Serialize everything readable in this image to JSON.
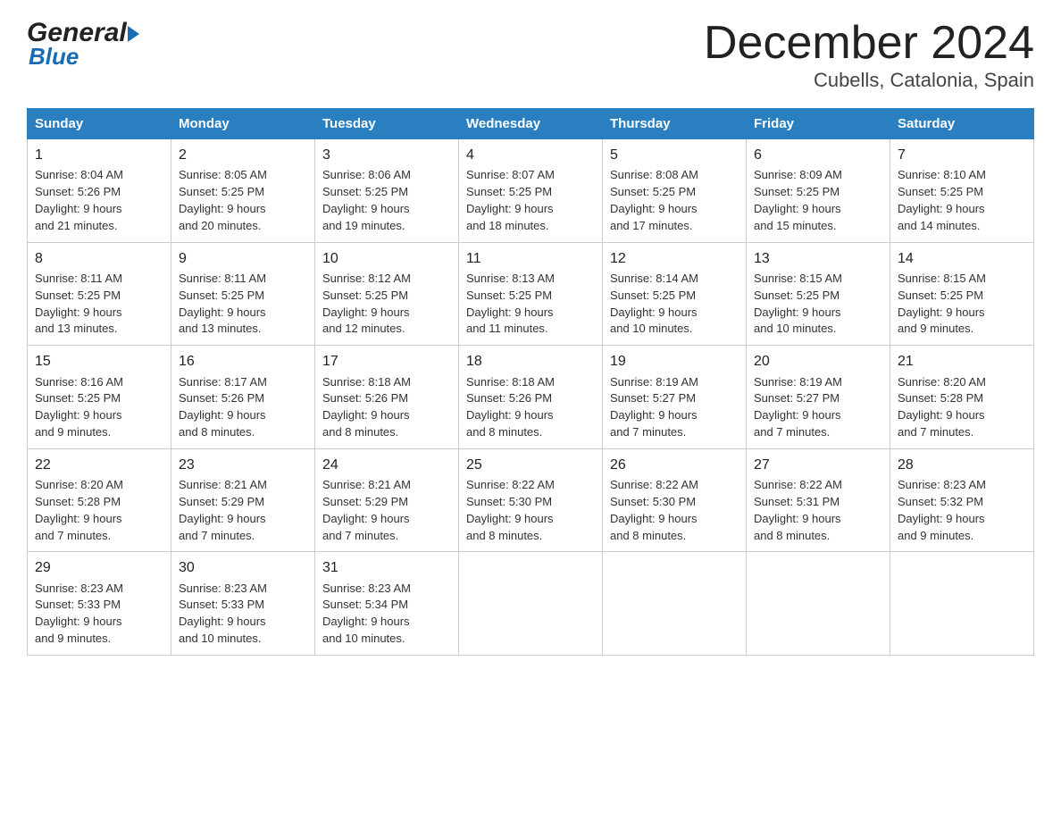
{
  "header": {
    "month": "December 2024",
    "location": "Cubells, Catalonia, Spain",
    "logo_general": "General",
    "logo_blue": "Blue"
  },
  "weekdays": [
    "Sunday",
    "Monday",
    "Tuesday",
    "Wednesday",
    "Thursday",
    "Friday",
    "Saturday"
  ],
  "weeks": [
    [
      {
        "day": "1",
        "sunrise": "8:04 AM",
        "sunset": "5:26 PM",
        "daylight": "9 hours and 21 minutes."
      },
      {
        "day": "2",
        "sunrise": "8:05 AM",
        "sunset": "5:25 PM",
        "daylight": "9 hours and 20 minutes."
      },
      {
        "day": "3",
        "sunrise": "8:06 AM",
        "sunset": "5:25 PM",
        "daylight": "9 hours and 19 minutes."
      },
      {
        "day": "4",
        "sunrise": "8:07 AM",
        "sunset": "5:25 PM",
        "daylight": "9 hours and 18 minutes."
      },
      {
        "day": "5",
        "sunrise": "8:08 AM",
        "sunset": "5:25 PM",
        "daylight": "9 hours and 17 minutes."
      },
      {
        "day": "6",
        "sunrise": "8:09 AM",
        "sunset": "5:25 PM",
        "daylight": "9 hours and 15 minutes."
      },
      {
        "day": "7",
        "sunrise": "8:10 AM",
        "sunset": "5:25 PM",
        "daylight": "9 hours and 14 minutes."
      }
    ],
    [
      {
        "day": "8",
        "sunrise": "8:11 AM",
        "sunset": "5:25 PM",
        "daylight": "9 hours and 13 minutes."
      },
      {
        "day": "9",
        "sunrise": "8:11 AM",
        "sunset": "5:25 PM",
        "daylight": "9 hours and 13 minutes."
      },
      {
        "day": "10",
        "sunrise": "8:12 AM",
        "sunset": "5:25 PM",
        "daylight": "9 hours and 12 minutes."
      },
      {
        "day": "11",
        "sunrise": "8:13 AM",
        "sunset": "5:25 PM",
        "daylight": "9 hours and 11 minutes."
      },
      {
        "day": "12",
        "sunrise": "8:14 AM",
        "sunset": "5:25 PM",
        "daylight": "9 hours and 10 minutes."
      },
      {
        "day": "13",
        "sunrise": "8:15 AM",
        "sunset": "5:25 PM",
        "daylight": "9 hours and 10 minutes."
      },
      {
        "day": "14",
        "sunrise": "8:15 AM",
        "sunset": "5:25 PM",
        "daylight": "9 hours and 9 minutes."
      }
    ],
    [
      {
        "day": "15",
        "sunrise": "8:16 AM",
        "sunset": "5:25 PM",
        "daylight": "9 hours and 9 minutes."
      },
      {
        "day": "16",
        "sunrise": "8:17 AM",
        "sunset": "5:26 PM",
        "daylight": "9 hours and 8 minutes."
      },
      {
        "day": "17",
        "sunrise": "8:18 AM",
        "sunset": "5:26 PM",
        "daylight": "9 hours and 8 minutes."
      },
      {
        "day": "18",
        "sunrise": "8:18 AM",
        "sunset": "5:26 PM",
        "daylight": "9 hours and 8 minutes."
      },
      {
        "day": "19",
        "sunrise": "8:19 AM",
        "sunset": "5:27 PM",
        "daylight": "9 hours and 7 minutes."
      },
      {
        "day": "20",
        "sunrise": "8:19 AM",
        "sunset": "5:27 PM",
        "daylight": "9 hours and 7 minutes."
      },
      {
        "day": "21",
        "sunrise": "8:20 AM",
        "sunset": "5:28 PM",
        "daylight": "9 hours and 7 minutes."
      }
    ],
    [
      {
        "day": "22",
        "sunrise": "8:20 AM",
        "sunset": "5:28 PM",
        "daylight": "9 hours and 7 minutes."
      },
      {
        "day": "23",
        "sunrise": "8:21 AM",
        "sunset": "5:29 PM",
        "daylight": "9 hours and 7 minutes."
      },
      {
        "day": "24",
        "sunrise": "8:21 AM",
        "sunset": "5:29 PM",
        "daylight": "9 hours and 7 minutes."
      },
      {
        "day": "25",
        "sunrise": "8:22 AM",
        "sunset": "5:30 PM",
        "daylight": "9 hours and 8 minutes."
      },
      {
        "day": "26",
        "sunrise": "8:22 AM",
        "sunset": "5:30 PM",
        "daylight": "9 hours and 8 minutes."
      },
      {
        "day": "27",
        "sunrise": "8:22 AM",
        "sunset": "5:31 PM",
        "daylight": "9 hours and 8 minutes."
      },
      {
        "day": "28",
        "sunrise": "8:23 AM",
        "sunset": "5:32 PM",
        "daylight": "9 hours and 9 minutes."
      }
    ],
    [
      {
        "day": "29",
        "sunrise": "8:23 AM",
        "sunset": "5:33 PM",
        "daylight": "9 hours and 9 minutes."
      },
      {
        "day": "30",
        "sunrise": "8:23 AM",
        "sunset": "5:33 PM",
        "daylight": "9 hours and 10 minutes."
      },
      {
        "day": "31",
        "sunrise": "8:23 AM",
        "sunset": "5:34 PM",
        "daylight": "9 hours and 10 minutes."
      },
      null,
      null,
      null,
      null
    ]
  ],
  "labels": {
    "sunrise": "Sunrise:",
    "sunset": "Sunset:",
    "daylight": "Daylight:"
  }
}
